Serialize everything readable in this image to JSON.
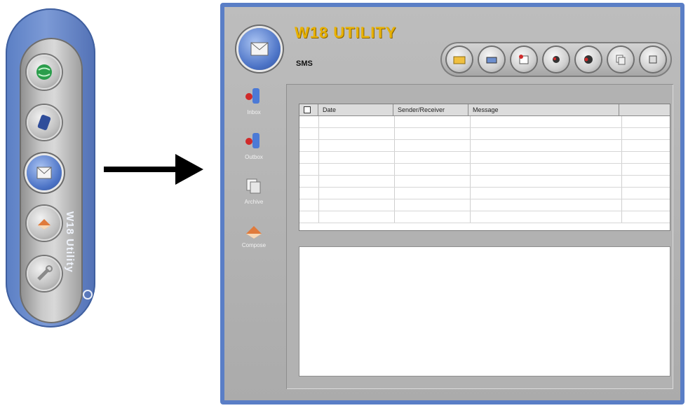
{
  "launcher": {
    "label": "W18 Utility",
    "buttons": [
      {
        "name": "internet",
        "icon": "globe-icon",
        "active": false
      },
      {
        "name": "phonebook",
        "icon": "phone-icon",
        "active": false
      },
      {
        "name": "sms",
        "icon": "envelope-icon",
        "active": true
      },
      {
        "name": "eraser",
        "icon": "eraser-icon",
        "active": false
      },
      {
        "name": "tools",
        "icon": "wrench-icon",
        "active": false
      }
    ]
  },
  "window": {
    "title": "W18 UTILITY",
    "subtitle": "SMS",
    "toolbar": [
      {
        "icon": "folder-icon"
      },
      {
        "icon": "printer-icon"
      },
      {
        "icon": "new-message-icon"
      },
      {
        "icon": "reply-icon"
      },
      {
        "icon": "forward-icon"
      },
      {
        "icon": "copy-icon"
      },
      {
        "icon": "close-icon"
      }
    ],
    "nav": [
      {
        "label": "Inbox",
        "icon": "inbox-icon"
      },
      {
        "label": "Outbox",
        "icon": "outbox-icon"
      },
      {
        "label": "Archive",
        "icon": "archive-icon"
      },
      {
        "label": "Compose",
        "icon": "compose-icon"
      }
    ],
    "table": {
      "columns": [
        "",
        "Date",
        "Sender/Receiver",
        "Message",
        ""
      ],
      "row_count": 9
    }
  },
  "colors": {
    "accent_blue": "#5a7ec6",
    "title_yellow": "#e8b100",
    "panel_gray": "#b2b2b2"
  }
}
